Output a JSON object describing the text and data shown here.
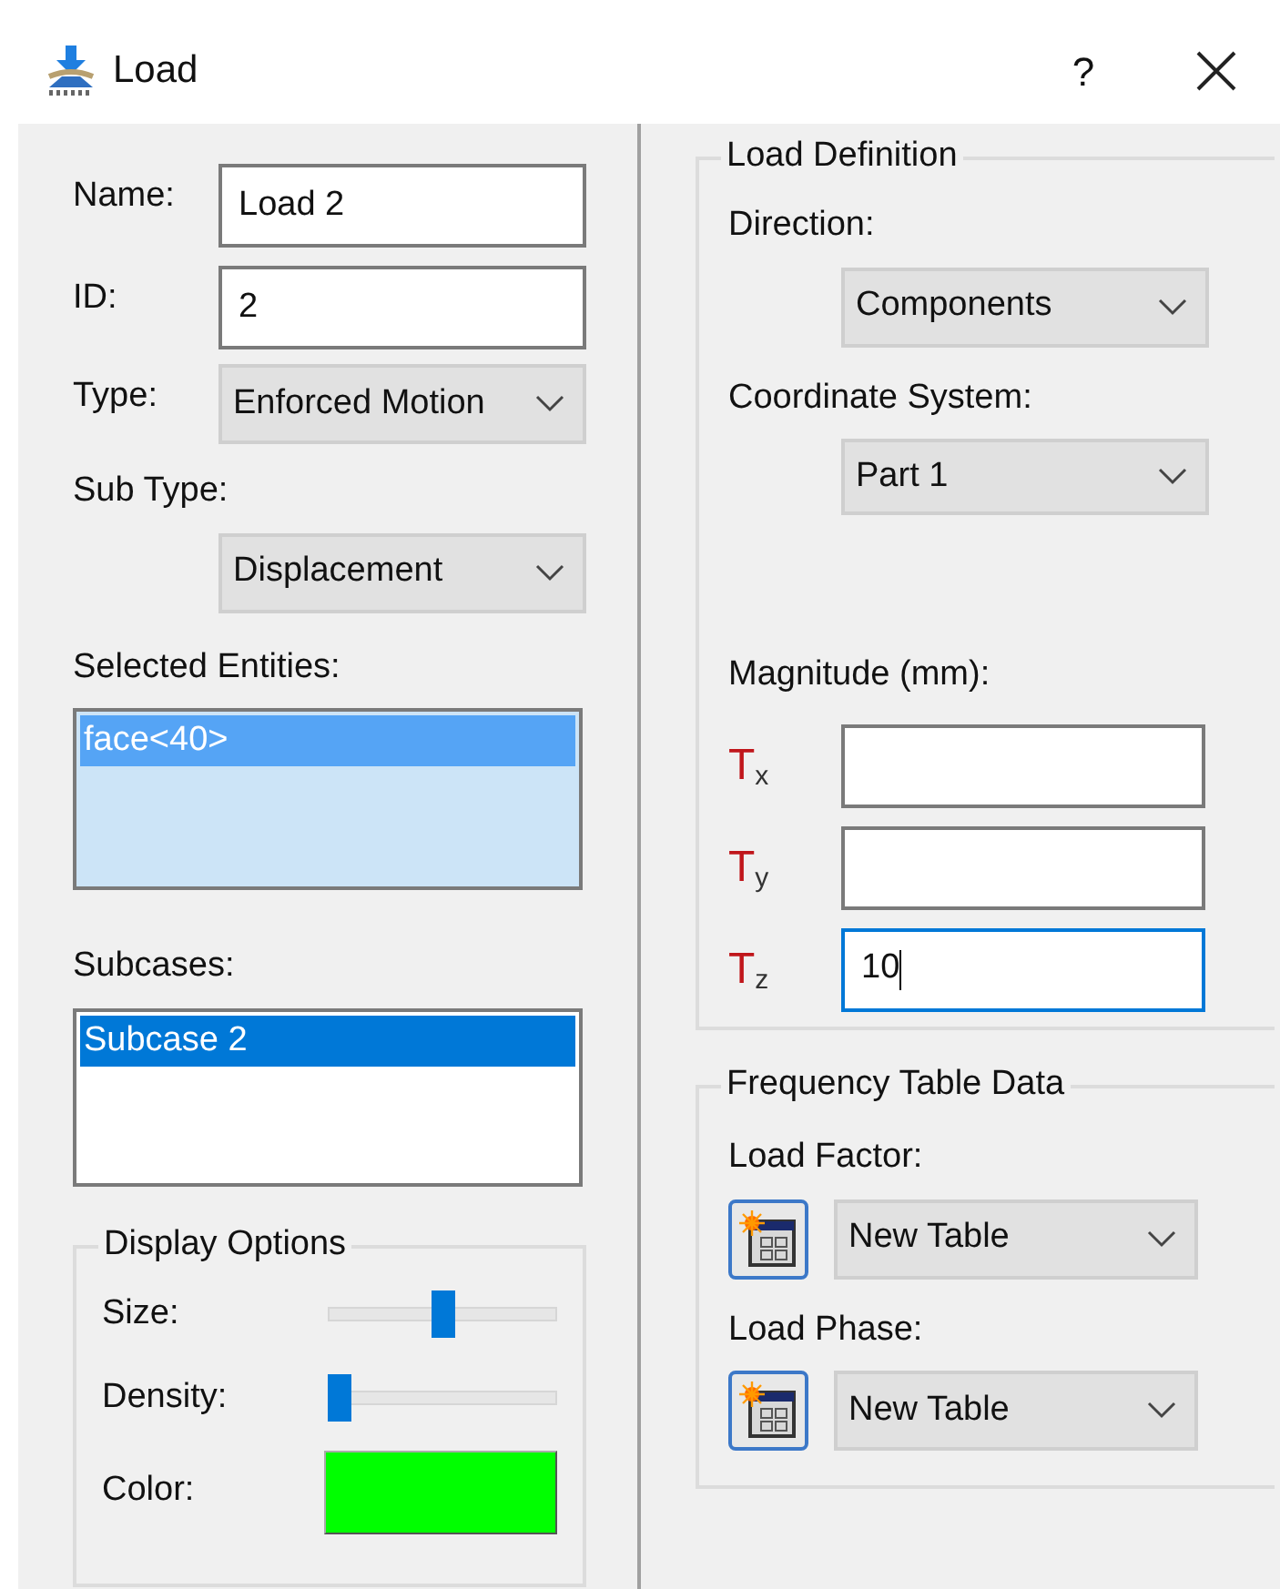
{
  "window": {
    "title": "Load",
    "help": "?"
  },
  "left": {
    "name": {
      "label": "Name:",
      "value": "Load 2"
    },
    "id": {
      "label": "ID:",
      "value": "2"
    },
    "type": {
      "label": "Type:",
      "value": "Enforced Motion"
    },
    "sub_type": {
      "label": "Sub Type:",
      "value": "Displacement"
    },
    "selected_entities": {
      "label": "Selected Entities:",
      "highlighted": true,
      "items": [
        {
          "text": "face<40>",
          "selected": true
        }
      ]
    },
    "subcases": {
      "label": "Subcases:",
      "highlighted": false,
      "items": [
        {
          "text": "Subcase 2",
          "selected": true
        }
      ]
    },
    "display_options": {
      "title": "Display Options",
      "size": {
        "label": "Size:",
        "level": 0.5
      },
      "density": {
        "label": "Density:",
        "level": 0
      },
      "color": {
        "label": "Color:",
        "color": "#00ff00"
      }
    }
  },
  "load_definition": {
    "title": "Load Definition",
    "direction": {
      "label": "Direction:",
      "value": "Components"
    },
    "coordinate_system": {
      "label": "Coordinate System:",
      "value": "Part 1"
    },
    "magnitude": {
      "label": "Magnitude (mm):",
      "components": [
        {
          "symbol": "T$_{x}$",
          "focused": false
        },
        {
          "symbol": "T$_{y}$",
          "focused": false
        },
        {
          "symbol": "T$_{z}$",
          "value": "10",
          "focused": true
        }
      ]
    }
  },
  "frequency_table_data": {
    "title": "Frequency Table Data",
    "load_factor": {
      "label": "Load Factor:",
      "value": "New Table"
    },
    "load_phase": {
      "label": "Load Phase:",
      "value": "New Table"
    }
  }
}
